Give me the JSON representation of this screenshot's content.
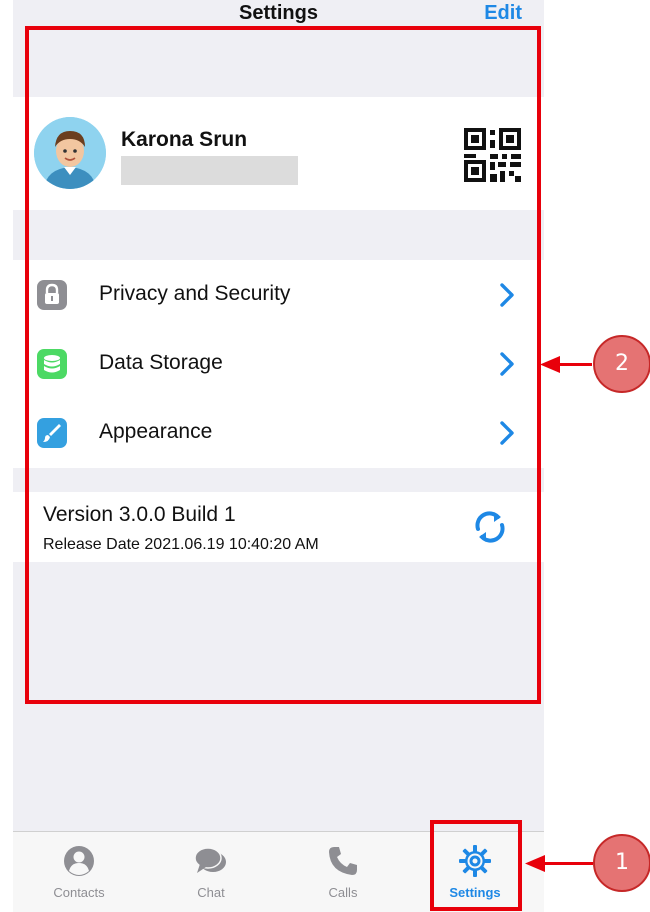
{
  "header": {
    "title": "Settings",
    "edit_label": "Edit"
  },
  "profile": {
    "name": "Karona Srun"
  },
  "menu": {
    "items": [
      {
        "label": "Privacy and Security",
        "icon": "lock-icon",
        "color": "#8e8e93"
      },
      {
        "label": "Data Storage",
        "icon": "database-icon",
        "color": "#4cd964"
      },
      {
        "label": "Appearance",
        "icon": "paintbrush-icon",
        "color": "#34a0e0"
      }
    ]
  },
  "version": {
    "title": "Version 3.0.0 Build 1",
    "release": "Release Date 2021.06.19 10:40:20 AM"
  },
  "tabbar": {
    "items": [
      {
        "label": "Contacts",
        "icon": "person-icon"
      },
      {
        "label": "Chat",
        "icon": "chat-bubbles-icon"
      },
      {
        "label": "Calls",
        "icon": "phone-icon"
      },
      {
        "label": "Settings",
        "icon": "gear-icon",
        "active": true
      }
    ]
  },
  "annotations": {
    "marker_1": "1",
    "marker_2": "2"
  },
  "colors": {
    "accent": "#1e88e5",
    "annotation": "#e8000b",
    "background": "#efeff4"
  }
}
